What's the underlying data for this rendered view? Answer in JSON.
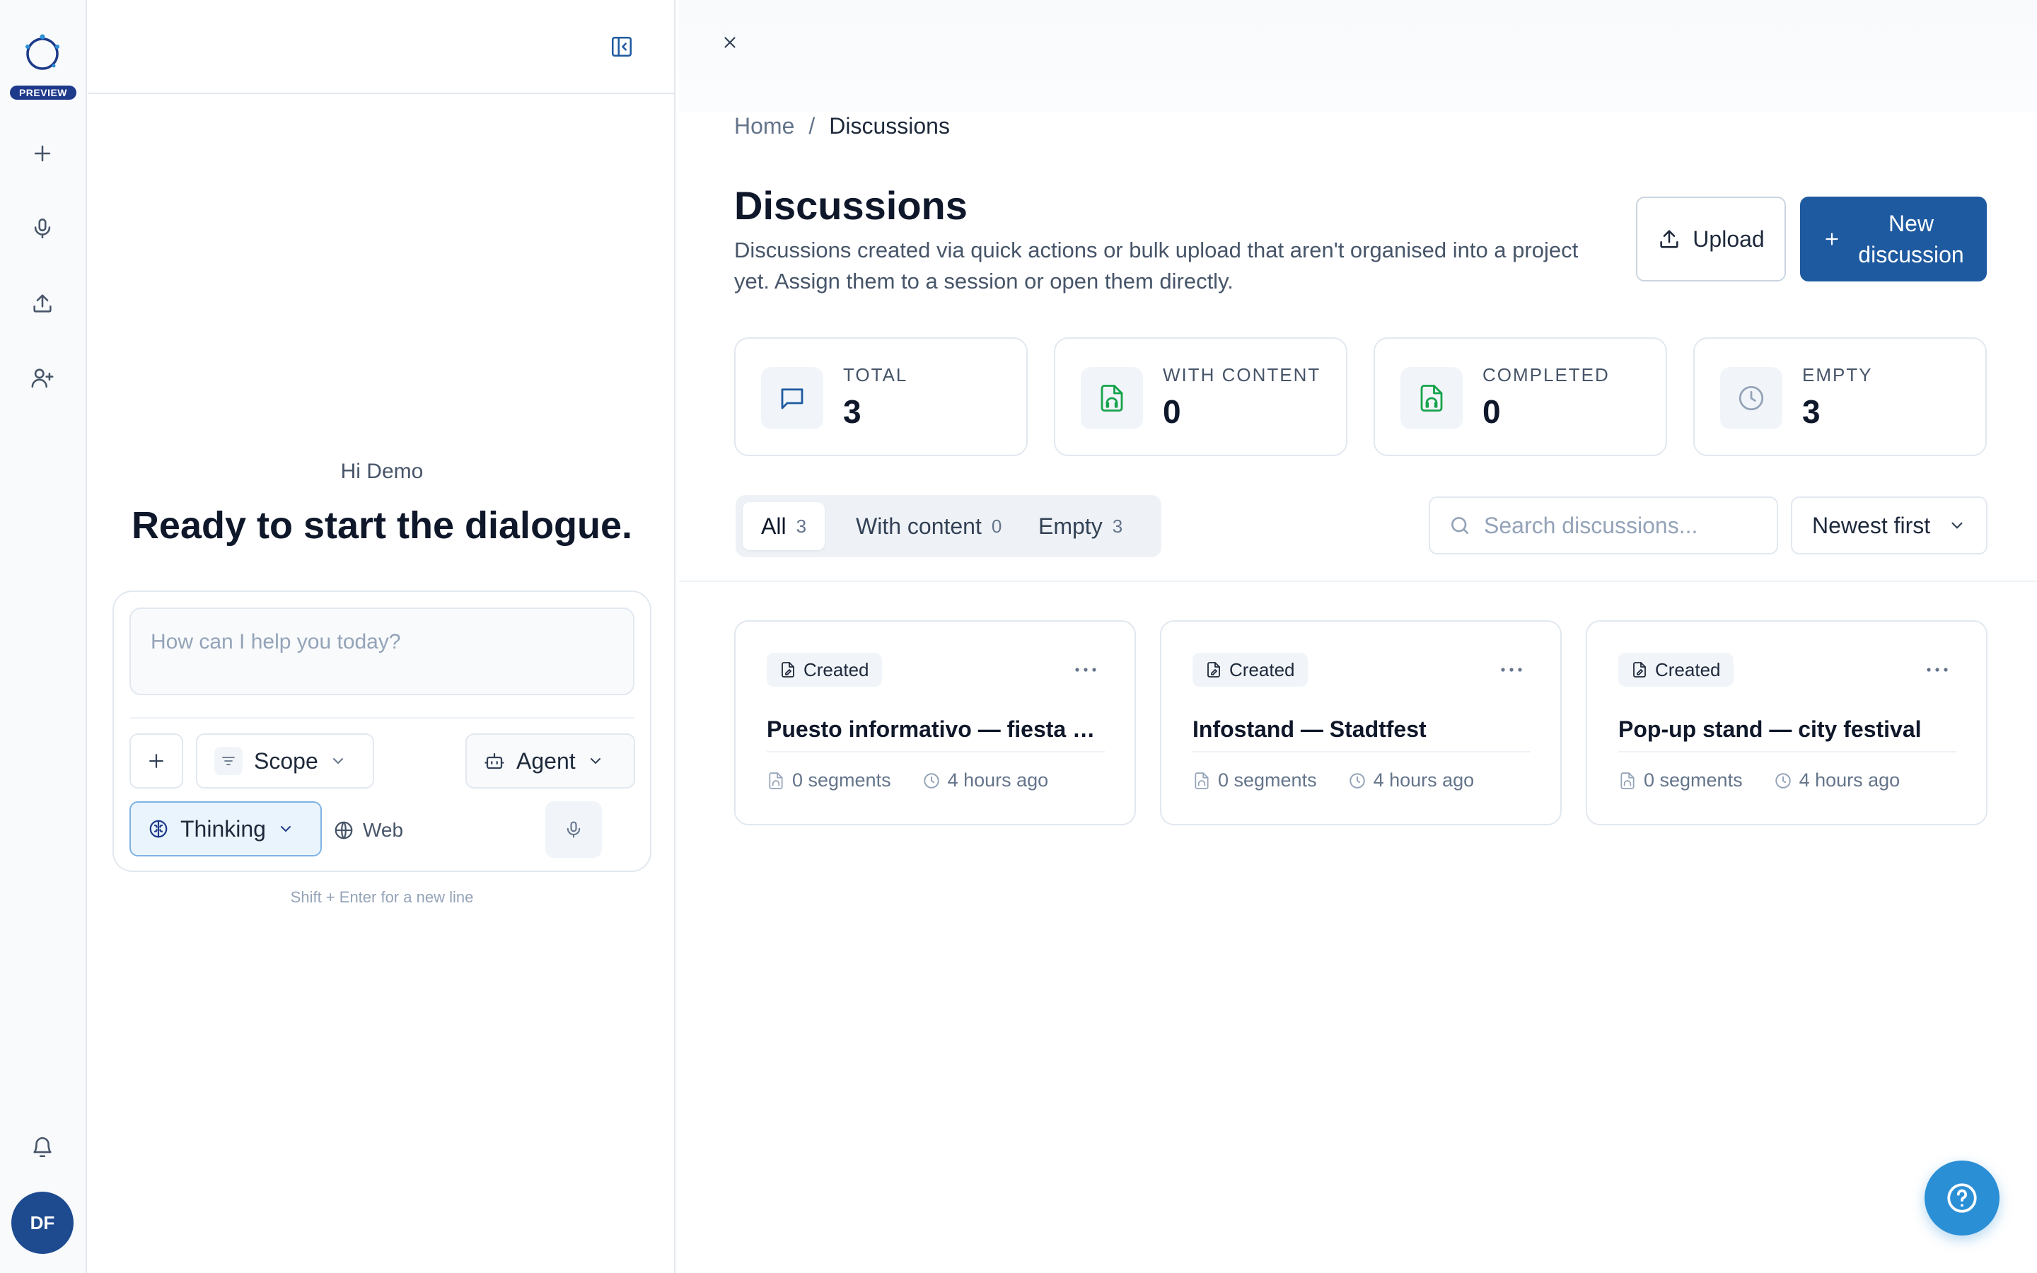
{
  "rail": {
    "badge": "PREVIEW",
    "avatar_initials": "DF",
    "icons": [
      "plus-icon",
      "mic-icon",
      "upload-icon",
      "user-plus-icon",
      "bell-icon"
    ]
  },
  "chat": {
    "greeting": "Hi Demo",
    "headline": "Ready to start the dialogue.",
    "prompt_placeholder": "How can I help you today?",
    "scope_label": "Scope",
    "agent_label": "Agent",
    "thinking_label": "Thinking",
    "web_label": "Web",
    "hint": "Shift + Enter for a new line"
  },
  "breadcrumb": {
    "home": "Home",
    "separator": "/",
    "current": "Discussions"
  },
  "page": {
    "title": "Discussions",
    "description": "Discussions created via quick actions or bulk upload that aren't organised into a project yet. Assign them to a session or open them directly.",
    "upload_label": "Upload",
    "new_label_line1": "New",
    "new_label_line2": "discussion"
  },
  "stats": [
    {
      "label": "TOTAL",
      "value": "3",
      "icon": "message-square-icon",
      "color": "#1e5aa0"
    },
    {
      "label": "WITH CONTENT",
      "value": "0",
      "icon": "file-audio-icon",
      "color": "#16a34a"
    },
    {
      "label": "COMPLETED",
      "value": "0",
      "icon": "file-audio-icon",
      "color": "#16a34a"
    },
    {
      "label": "EMPTY",
      "value": "3",
      "icon": "clock-icon",
      "color": "#94a3b8"
    }
  ],
  "tabs": [
    {
      "label": "All",
      "count": "3"
    },
    {
      "label": "With content",
      "count": "0"
    },
    {
      "label": "Empty",
      "count": "3"
    }
  ],
  "search": {
    "placeholder": "Search discussions..."
  },
  "sort": {
    "value": "Newest first"
  },
  "cards": [
    {
      "badge": "Created",
      "title": "Puesto informativo — fiesta d...",
      "segments": "0 segments",
      "time": "4 hours ago"
    },
    {
      "badge": "Created",
      "title": "Infostand — Stadtfest",
      "segments": "0 segments",
      "time": "4 hours ago"
    },
    {
      "badge": "Created",
      "title": "Pop-up stand — city festival",
      "segments": "0 segments",
      "time": "4 hours ago"
    }
  ],
  "colors": {
    "primary": "#1e5aa0",
    "help": "#2b8fd6",
    "badge": "#1e3a8a"
  }
}
